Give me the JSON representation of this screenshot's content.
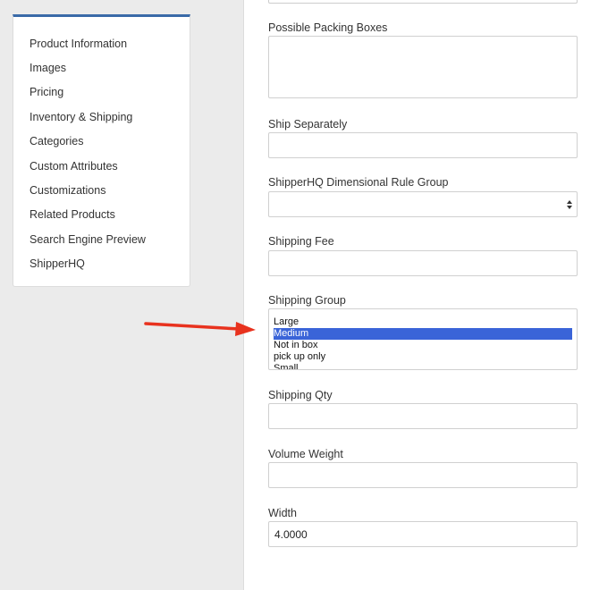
{
  "sidebar": {
    "items": [
      {
        "label": "Product Information"
      },
      {
        "label": "Images"
      },
      {
        "label": "Pricing"
      },
      {
        "label": "Inventory & Shipping"
      },
      {
        "label": "Categories"
      },
      {
        "label": "Custom Attributes"
      },
      {
        "label": "Customizations"
      },
      {
        "label": "Related Products"
      },
      {
        "label": "Search Engine Preview"
      },
      {
        "label": "ShipperHQ"
      }
    ]
  },
  "fields": {
    "possible_packing_boxes": {
      "label": "Possible Packing Boxes",
      "value": ""
    },
    "ship_separately": {
      "label": "Ship Separately",
      "value": ""
    },
    "dimensional_rule_group": {
      "label": "ShipperHQ Dimensional Rule Group",
      "value": ""
    },
    "shipping_fee": {
      "label": "Shipping Fee",
      "value": ""
    },
    "shipping_group": {
      "label": "Shipping Group",
      "options": [
        "Large",
        "Medium",
        "Not in box",
        "pick up only",
        "Small"
      ],
      "selected": "Medium"
    },
    "shipping_qty": {
      "label": "Shipping Qty",
      "value": ""
    },
    "volume_weight": {
      "label": "Volume Weight",
      "value": ""
    },
    "width": {
      "label": "Width",
      "value": "4.0000"
    }
  },
  "colors": {
    "accent": "#3a6aa8",
    "selection": "#3a64d8",
    "annotation_arrow": "#e8321e"
  },
  "icons": {
    "select_arrow": "chevron-up-down-icon",
    "annotation": "red-arrow-pointer"
  }
}
